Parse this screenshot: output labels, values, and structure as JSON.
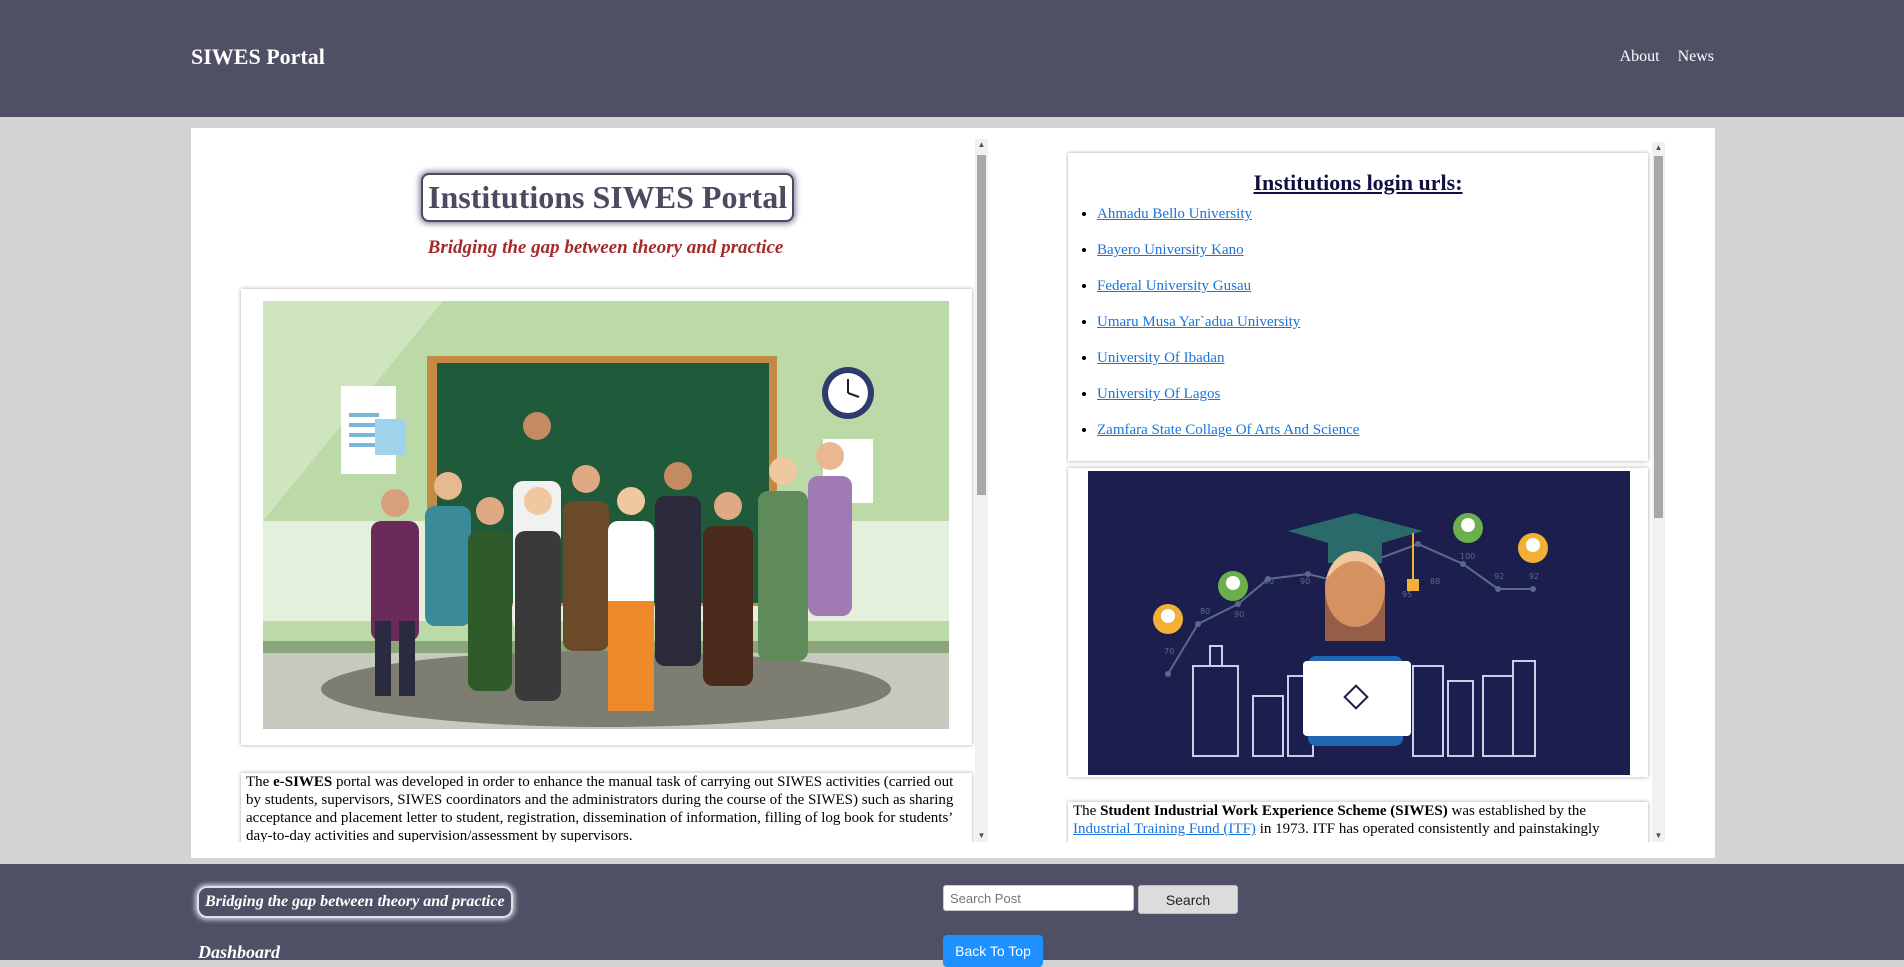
{
  "header": {
    "brand": "SIWES Portal",
    "nav": [
      {
        "label": "About"
      },
      {
        "label": "News"
      }
    ]
  },
  "hero": {
    "title": "Institutions SIWES Portal",
    "tagline": "Bridging the gap between theory and practice"
  },
  "intro": {
    "prefix": "The ",
    "bold": "e-SIWES",
    "text": " portal was developed in order to enhance the manual task of carrying out SIWES activities (carried out by students, supervisors, SIWES coordinators and the administrators during the course of the SIWES) such as sharing acceptance and placement letter to student, registration, dissemination of information, filling of log book for students’ day-to-day activities and supervision/assessment by supervisors."
  },
  "institutions": {
    "title": "Institutions login urls:",
    "items": [
      {
        "label": "Ahmadu Bello University"
      },
      {
        "label": "Bayero University Kano"
      },
      {
        "label": "Federal University Gusau"
      },
      {
        "label": "Umaru Musa Yar`adua University"
      },
      {
        "label": "University Of Ibadan"
      },
      {
        "label": "University Of Lagos"
      },
      {
        "label": "Zamfara State Collage Of Arts And Science"
      }
    ]
  },
  "about": {
    "prefix": "The ",
    "bold": "Student Industrial Work Experience Scheme (SIWES)",
    "mid": " was established by the ",
    "link": "Industrial Training Fund (ITF)",
    "suffix": " in 1973. ITF has operated consistently and painstakingly"
  },
  "footer": {
    "tagline": "Bridging the gap between theory and practice",
    "dashboard": "Dashboard",
    "search_placeholder": "Search Post",
    "search_label": "Search",
    "back_to_top": "Back To Top"
  },
  "colors": {
    "header_bg": "#4f4f66",
    "tagline": "#a52a2a",
    "link": "#1a73d9",
    "primary_button": "#1e90ff"
  },
  "graphic_numbers": [
    "70",
    "80",
    "90",
    "90",
    "90",
    "100",
    "88",
    "95",
    "92",
    "92",
    "90"
  ]
}
